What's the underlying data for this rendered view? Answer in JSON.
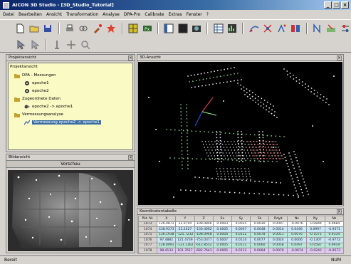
{
  "window": {
    "title": "AICON 3D Studio - [3D_Studio_Tutorial]",
    "minimize": "_",
    "maximize": "□",
    "close": "×"
  },
  "menu": [
    "Datei",
    "Bearbeiten",
    "Ansicht",
    "Transformation",
    "Analyse",
    "DPA-Pro",
    "Calibrate",
    "Extras",
    "Fenster",
    "?"
  ],
  "project_panel": {
    "title": "Projektansicht",
    "close": "×",
    "root": "Projektansicht",
    "nodes": [
      {
        "label": "DPA - Messungen",
        "level": 1
      },
      {
        "label": "epoche1",
        "level": 2
      },
      {
        "label": "epoche2",
        "level": 2
      },
      {
        "label": "Zugeordnete Daten",
        "level": 1
      },
      {
        "label": "epoche2 -> epoche1",
        "level": 2
      },
      {
        "label": "Vermessungsanalyse",
        "level": 1
      },
      {
        "label": "Vermessung epoche2 -> epoche1",
        "level": 2,
        "selected": true
      }
    ]
  },
  "image_panel": {
    "title": "Bildansicht",
    "close": "×",
    "subtitle": "Vorschau"
  },
  "view3d": {
    "title": "3D-Ansicht",
    "close": "×"
  },
  "coords_panel": {
    "title": "Koordinatentabelle",
    "close": "×",
    "columns": [
      "Pkt. Nr.",
      "X",
      "Y",
      "Z",
      "Sx",
      "Sy",
      "Sz",
      "Rdyd",
      "Nx",
      "Ny",
      "Nz"
    ],
    "rows": [
      [
        "1073",
        "126.0871",
        "22.9794",
        "-108.0846",
        "0.0003",
        "0.0035",
        "0.0030",
        "0.0007",
        "-0.0976",
        "-0.0844",
        "0.9684"
      ],
      [
        "1074",
        "438.9373",
        "23.2427",
        "-130.4062",
        "0.0005",
        "0.0047",
        "0.0048",
        "0.0014",
        "0.0446",
        "0.0997",
        "-0.9371"
      ],
      [
        "1075",
        "136.1938",
        "-125.7232",
        "-108.0948",
        "0.0004",
        "0.0112",
        "0.0078",
        "0.0011",
        "0.0076",
        "-0.1071",
        "0.9334"
      ],
      [
        "1076",
        "97.4882",
        "121.4739",
        "-753.0377",
        "0.0007",
        "0.0114",
        "0.0077",
        "0.0024",
        "0.0006",
        "-0.1307",
        "-0.9772"
      ],
      [
        "1077",
        "128.0091",
        "-131.1302",
        "-612.8552",
        "0.0005",
        "0.0111",
        "0.0060",
        "0.0058",
        "0.0497",
        "-0.0587",
        "0.9919"
      ],
      [
        "1078",
        "98.4133",
        "101.7617",
        "-682.7643",
        "0.0005",
        "0.0112",
        "0.0084",
        "0.0078",
        "-0.0074",
        "-0.0242",
        "-0.9573"
      ]
    ]
  },
  "status": {
    "left": "Bereit",
    "right": "NUM"
  },
  "colors": {
    "tree_bg": "#fafac4",
    "selection": "#3a6ea5",
    "view_bg": "#000000",
    "points_primary": "#e8e8f0",
    "points_green": "#7ec87a",
    "points_red": "#d24040"
  }
}
